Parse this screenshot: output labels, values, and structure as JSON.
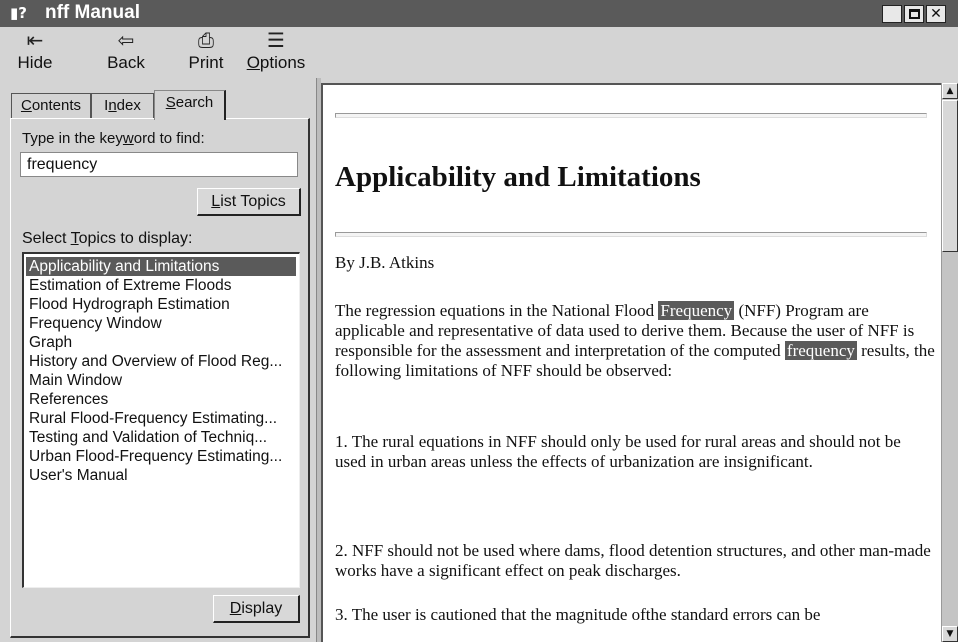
{
  "window": {
    "title": "nff Manual",
    "icon": "help-book-icon",
    "title_icon_glyph": "▮?",
    "controls": {
      "minimize": "",
      "maximize": "",
      "close": "✕"
    }
  },
  "toolbar": {
    "hide": {
      "label_pre": "",
      "label_ul": "",
      "label": "Hide",
      "icon": "hide-pane-icon",
      "glyph": "⇤"
    },
    "back": {
      "label": "Back",
      "icon": "back-arrow-icon",
      "glyph": "⇦"
    },
    "print": {
      "label": "Print",
      "icon": "printer-icon",
      "glyph": "⎙"
    },
    "options": {
      "label_ul": "O",
      "label_rest": "ptions",
      "icon": "options-icon",
      "glyph": "☰"
    }
  },
  "tabs": {
    "contents": {
      "label_ul": "C",
      "label_rest": "ontents"
    },
    "index": {
      "label_pre": "I",
      "label_ul": "n",
      "label_rest": "dex"
    },
    "search": {
      "label_ul": "S",
      "label_rest": "earch",
      "active": true
    }
  },
  "search": {
    "keyword_label_pre": "Type in the key",
    "keyword_label_ul": "w",
    "keyword_label_post": "ord to find:",
    "keyword_value": "frequency",
    "list_topics_ul": "L",
    "list_topics_rest": "ist Topics",
    "topics_label_pre": "Select ",
    "topics_label_ul": "T",
    "topics_label_post": "opics to display:",
    "topics": [
      "Applicability and Limitations",
      "Estimation of Extreme Floods",
      "Flood Hydrograph Estimation",
      "Frequency Window",
      "Graph",
      "History and Overview of Flood Reg...",
      "Main Window",
      "References",
      "Rural Flood-Frequency Estimating...",
      "Testing and Validation of Techniq...",
      "Urban Flood-Frequency Estimating...",
      "User's Manual"
    ],
    "selected_index": 0,
    "display_ul": "D",
    "display_rest": "isplay"
  },
  "document": {
    "title": "Applicability and Limitations",
    "author": "By J.B. Atkins",
    "p1_a": "The regression equations in the National Flood ",
    "p1_hl1": "Frequency",
    "p1_b": " (NFF) Program are applicable and representative of data used to derive them. Because the user of NFF is responsible for the assessment and interpretation of the computed ",
    "p1_hl2": "frequency",
    "p1_c": " results, the following limitations of NFF should be observed:",
    "p2": "1.  The rural equations in NFF should only be used for rural areas and should not be used in urban areas unless the effects of urbanization are insignificant.",
    "p3": "2. NFF should not be used where dams, flood detention structures, and other man-made works have a significant effect on peak discharges.",
    "p4": "3. The user is cautioned that the magnitude ofthe standard errors can be"
  },
  "scrollbar": {
    "up": "▲",
    "down": "▼",
    "position": 0.0
  }
}
